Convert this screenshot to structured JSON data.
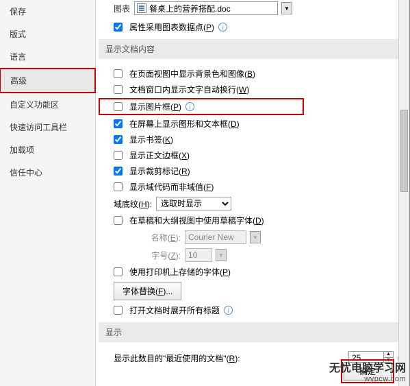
{
  "sidebar": {
    "items": [
      {
        "label": "保存"
      },
      {
        "label": "版式"
      },
      {
        "label": "语言"
      },
      {
        "label": "高级"
      },
      {
        "label": "自定义功能区"
      },
      {
        "label": "快速访问工具栏"
      },
      {
        "label": "加载项"
      },
      {
        "label": "信任中心"
      }
    ]
  },
  "top": {
    "chart_label": "图表",
    "chart_value": "餐桌上的营养搭配.doc",
    "attr_label_pre": "属性采用图表数据点(",
    "attr_key": "P",
    "attr_label_post": ")"
  },
  "section1": {
    "title": "显示文档内容"
  },
  "opts": {
    "bg_pre": "在页面视图中显示背景色和图像(",
    "bg_key": "B",
    "bg_post": ")",
    "wrap_pre": "文档窗口内显示文字自动换行(",
    "wrap_key": "W",
    "wrap_post": ")",
    "picframe_pre": "显示图片框(",
    "picframe_key": "P",
    "picframe_post": ")",
    "drawtxt_pre": "在屏幕上显示图形和文本框(",
    "drawtxt_key": "D",
    "drawtxt_post": ")",
    "bookmark_pre": "显示书签(",
    "bookmark_key": "K",
    "bookmark_post": ")",
    "border_pre": "显示正文边框(",
    "border_key": "X",
    "border_post": ")",
    "crop_pre": "显示裁剪标记(",
    "crop_key": "R",
    "crop_post": ")",
    "fieldcode_pre": "显示域代码而非域值(",
    "fieldcode_key": "F",
    "fieldcode_post": ")",
    "shade_label_pre": "域底纹(",
    "shade_key": "H",
    "shade_label_post": "):",
    "shade_value": "选取时显示",
    "draftfont_pre": "在草稿和大纲视图中使用草稿字体(",
    "draftfont_key": "D",
    "draftfont_post": ")",
    "fontname_label_pre": "名称(",
    "fontname_key": "E",
    "fontname_label_post": "):",
    "fontname_value": "Courier New",
    "fontsize_label_pre": "字号(",
    "fontsize_key": "Z",
    "fontsize_label_post": "):",
    "fontsize_value": "10",
    "printerfont_pre": "使用打印机上存储的字体(",
    "printerfont_key": "P",
    "printerfont_post": ")",
    "fontsub_pre": "字体替换(",
    "fontsub_key": "F",
    "fontsub_post": ")...",
    "expandhead_pre": "打开文档时展开所有标题",
    "expandhead_post": ""
  },
  "section2": {
    "title": "显示"
  },
  "recent": {
    "label_pre": "显示此数目的\"最近使用的文档\"(",
    "label_key": "R",
    "label_post": "):",
    "value": "25"
  },
  "footer": {
    "ok": "确定"
  },
  "watermark": {
    "line1": "无忧电脑学习网",
    "line2": "wypcw.com"
  }
}
